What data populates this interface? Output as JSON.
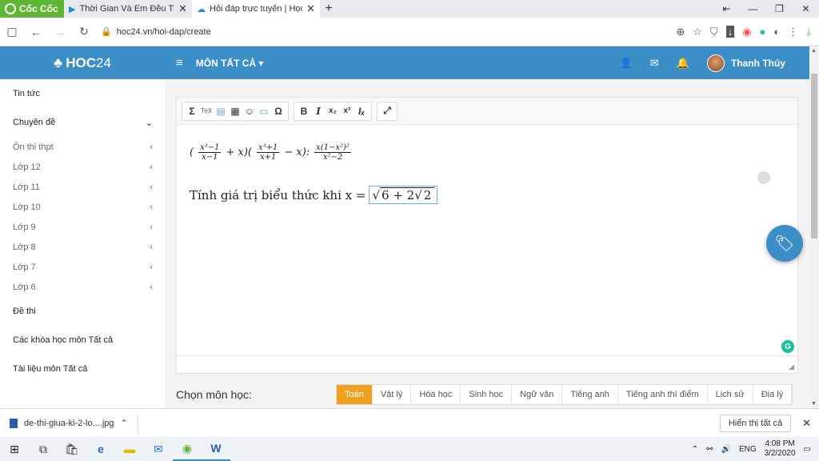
{
  "browser": {
    "brand": "Cốc Cốc",
    "tabs": [
      {
        "title": "Thời Gian Và Em Đều Thật Nó",
        "icon": "play-icon"
      },
      {
        "title": "Hỏi đáp trực tuyến | Học trực",
        "icon": "cloud-icon"
      }
    ],
    "url": "hoc24.vn/hoi-dap/create"
  },
  "nav": {
    "brand_bold": "HOC",
    "brand_num": "24",
    "menu_label": "MÔN TẤT CẢ",
    "user_name": "Thanh Thúy"
  },
  "sidebar": {
    "items": [
      {
        "label": "Tin tức",
        "chevron": ""
      },
      {
        "label": "Chuyên đề",
        "chevron": "⌄"
      },
      {
        "label": "Ôn thi thpt",
        "chevron": "‹"
      },
      {
        "label": "Lớp 12",
        "chevron": "‹"
      },
      {
        "label": "Lớp 11",
        "chevron": "‹"
      },
      {
        "label": "Lớp 10",
        "chevron": "‹"
      },
      {
        "label": "Lớp 9",
        "chevron": "‹"
      },
      {
        "label": "Lớp 8",
        "chevron": "‹"
      },
      {
        "label": "Lớp 7",
        "chevron": "‹"
      },
      {
        "label": "Lớp 6",
        "chevron": "‹"
      },
      {
        "label": "Đề thi",
        "chevron": ""
      },
      {
        "label": "Các khóa học môn Tất cả",
        "chevron": ""
      },
      {
        "label": "Tài liệu môn Tất cả",
        "chevron": ""
      }
    ]
  },
  "editor": {
    "question": "Tính giá trị biểu thức khi x ="
  },
  "subjects": {
    "label": "Chọn môn học:",
    "items": [
      "Toán",
      "Vật lý",
      "Hóa học",
      "Sinh học",
      "Ngữ văn",
      "Tiếng anh",
      "Tiếng anh thí điểm",
      "Lịch sử",
      "Địa lý"
    ],
    "selected": "Toán"
  },
  "downloads": {
    "file": "de-thi-giua-ki-2-lo....jpg",
    "show_all": "Hiển thị tất cả"
  },
  "taskbar": {
    "lang": "ENG",
    "time": "4:08 PM",
    "date": "3/2/2020"
  }
}
